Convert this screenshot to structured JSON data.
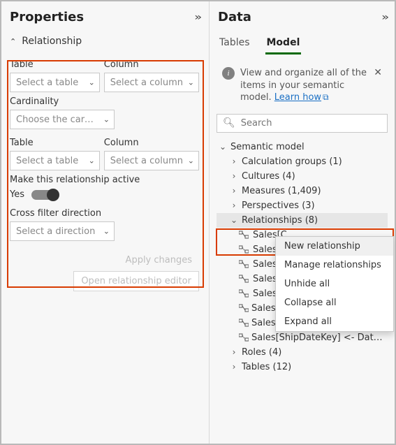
{
  "properties": {
    "title": "Properties",
    "section": "Relationship",
    "table1": {
      "label": "Table",
      "placeholder": "Select a table"
    },
    "column1": {
      "label": "Column",
      "placeholder": "Select a column"
    },
    "cardinality": {
      "label": "Cardinality",
      "placeholder": "Choose the cardin…"
    },
    "table2": {
      "label": "Table",
      "placeholder": "Select a table"
    },
    "column2": {
      "label": "Column",
      "placeholder": "Select a column"
    },
    "active": {
      "label": "Make this relationship active",
      "value": "Yes"
    },
    "cross_filter": {
      "label": "Cross filter direction",
      "placeholder": "Select a direction"
    },
    "apply_btn": "Apply changes",
    "editor_btn": "Open relationship editor"
  },
  "data": {
    "title": "Data",
    "tabs": {
      "tables": "Tables",
      "model": "Model"
    },
    "info_prefix": "View and organize all of the items in your semantic model. ",
    "info_link": "Learn how",
    "search_placeholder": "Search",
    "tree": {
      "root": "Semantic model",
      "calc_groups": "Calculation groups (1)",
      "cultures": "Cultures (4)",
      "measures": "Measures (1,409)",
      "perspectives": "Perspectives (3)",
      "relationships": "Relationships (8)",
      "rel_items": [
        "Sales[CustomerKey] <- Customer[Custome…",
        "Sales[DueDateKey] <- Date[DateKey]",
        "Sales[OrderDateKey] <- Date[DateKey]",
        "Sales[ProductKey] <- Product[ProductKey]",
        "Sales[ResellerKey] <- Reseller[ResellerK…",
        "Sales[SalesOrderLineKey] — Sales Or…",
        "Sales[SalesTerritoryKey] <- Sales Te…",
        "Sales[ShipDateKey] <- Date[DateKey]"
      ],
      "rel_items_trunc": [
        "Sales[C",
        "Sales[D",
        "Sales[O",
        "Sales[P",
        "Sales[R"
      ],
      "roles": "Roles (4)",
      "tables": "Tables (12)"
    }
  },
  "menu": {
    "new_rel": "New relationship",
    "manage": "Manage relationships",
    "unhide": "Unhide all",
    "collapse": "Collapse all",
    "expand": "Expand all"
  }
}
